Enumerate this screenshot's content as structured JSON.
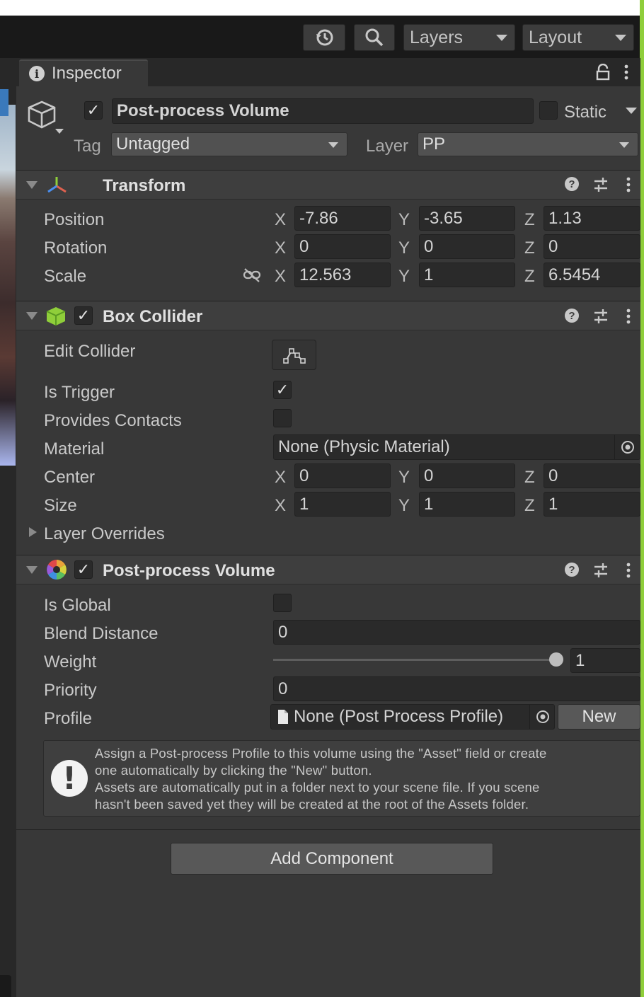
{
  "toolbar": {
    "history_icon": "history-icon",
    "search_icon": "search-icon",
    "layers_label": "Layers",
    "layout_label": "Layout"
  },
  "inspector": {
    "tab_label": "Inspector",
    "lock_icon": "lock-icon",
    "menu_icon": "kebab-menu-icon"
  },
  "object": {
    "active": true,
    "name": "Post-process Volume",
    "static_label": "Static",
    "static_checked": false,
    "tag_label": "Tag",
    "tag_value": "Untagged",
    "layer_label": "Layer",
    "layer_value": "PP"
  },
  "transform": {
    "title": "Transform",
    "position_label": "Position",
    "rotation_label": "Rotation",
    "scale_label": "Scale",
    "axis_x": "X",
    "axis_y": "Y",
    "axis_z": "Z",
    "position": {
      "x": "-7.86",
      "y": "-3.65",
      "z": "1.13"
    },
    "rotation": {
      "x": "0",
      "y": "0",
      "z": "0"
    },
    "scale": {
      "x": "12.563",
      "y": "1",
      "z": "6.5454"
    }
  },
  "box_collider": {
    "title": "Box Collider",
    "enabled": true,
    "edit_collider_label": "Edit Collider",
    "is_trigger_label": "Is Trigger",
    "is_trigger": true,
    "provides_contacts_label": "Provides Contacts",
    "provides_contacts": false,
    "material_label": "Material",
    "material_value": "None (Physic Material)",
    "center_label": "Center",
    "center": {
      "x": "0",
      "y": "0",
      "z": "0"
    },
    "size_label": "Size",
    "size": {
      "x": "1",
      "y": "1",
      "z": "1"
    },
    "layer_overrides_label": "Layer Overrides"
  },
  "post_process": {
    "title": "Post-process Volume",
    "enabled": true,
    "is_global_label": "Is Global",
    "is_global": false,
    "blend_distance_label": "Blend Distance",
    "blend_distance": "0",
    "weight_label": "Weight",
    "weight": "1",
    "weight_fraction": 1.0,
    "priority_label": "Priority",
    "priority": "0",
    "profile_label": "Profile",
    "profile_value": "None (Post Process Profile)",
    "new_label": "New",
    "help_line1": "Assign a Post-process Profile to this volume using the \"Asset\" field or create",
    "help_line2": "one automatically by clicking the \"New\" button.",
    "help_line3": "Assets are automatically put in a folder next to your scene file. If you scene",
    "help_line4": "hasn't been saved yet they will be created at the root of the Assets folder."
  },
  "add_component_label": "Add Component",
  "colors": {
    "accent_green": "#8fce3a",
    "panel_bg": "#383838",
    "toolbar_bg": "#191919"
  }
}
